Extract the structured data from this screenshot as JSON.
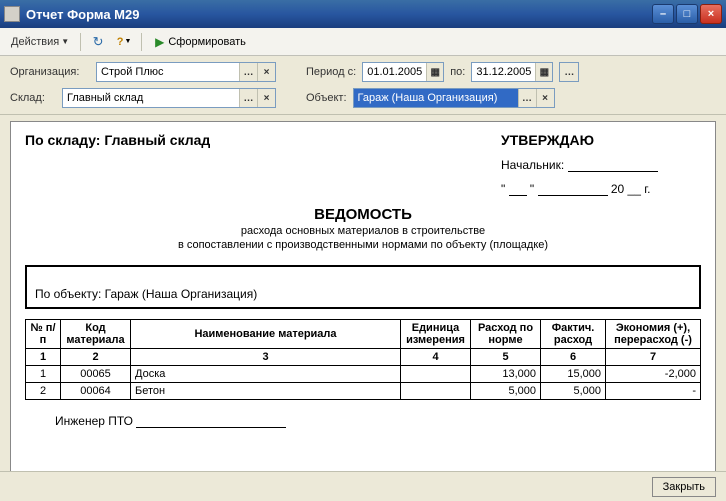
{
  "window": {
    "title": "Отчет  Форма М29"
  },
  "toolbar": {
    "actions_label": "Действия",
    "generate_label": "Сформировать"
  },
  "params": {
    "org_label": "Организация:",
    "org_value": "Строй Плюс",
    "period_label": "Период с:",
    "period_from": "01.01.2005",
    "period_to_label": "по:",
    "period_to": "31.12.2005",
    "warehouse_label": "Склад:",
    "warehouse_value": "Главный склад",
    "object_label": "Объект:",
    "object_value": "Гараж (Наша Организация)"
  },
  "doc": {
    "by_warehouse_label": "По складу: Главный склад",
    "approve": "УТВЕРЖДАЮ",
    "chief_label": "Начальник:",
    "date_tail": "20 __ г.",
    "title": "ВЕДОМОСТЬ",
    "subtitle1": "расхода основных материалов в строительстве",
    "subtitle2": "в сопоставлении с производственными нормами по объекту (площадке)",
    "by_object_label": "По объекту: Гараж (Наша Организация)",
    "engineer_label": "Инженер ПТО"
  },
  "table": {
    "headers": {
      "num": "№ п/п",
      "code": "Код материала",
      "name": "Наименование материала",
      "unit": "Единица измерения",
      "norm": "Расход по норме",
      "fact": "Фактич. расход",
      "econ": "Экономия (+), перерасход (-)"
    },
    "colnums": {
      "c1": "1",
      "c2": "2",
      "c3": "3",
      "c4": "4",
      "c5": "5",
      "c6": "6",
      "c7": "7"
    },
    "rows": [
      {
        "n": "1",
        "code": "00065",
        "name": "Доска",
        "unit": "",
        "norm": "13,000",
        "fact": "15,000",
        "econ": "-2,000"
      },
      {
        "n": "2",
        "code": "00064",
        "name": "Бетон",
        "unit": "",
        "norm": "5,000",
        "fact": "5,000",
        "econ": "-"
      }
    ]
  },
  "footer": {
    "close_label": "Закрыть"
  }
}
